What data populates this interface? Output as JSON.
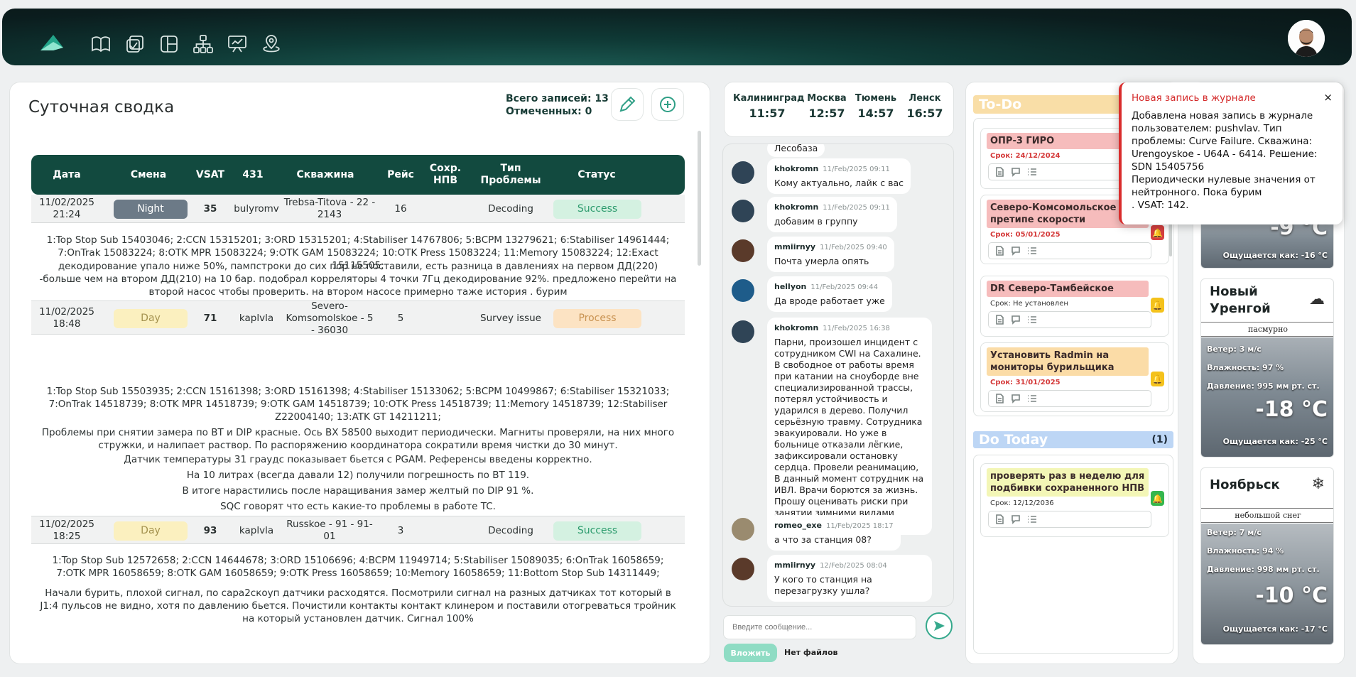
{
  "app": {
    "colors": {
      "primary": "#124a3f",
      "accent": "#35a98c",
      "alert": "#d92c2c"
    }
  },
  "nav": {
    "icons": [
      "book-icon",
      "checklist-icon",
      "layout-icon",
      "hierarchy-icon",
      "presentation-icon",
      "map-pin-icon"
    ]
  },
  "summary": {
    "title": "Суточная сводка",
    "total_label": "Всего записей: 13",
    "marked_label": "Отмеченных: 0",
    "columns": [
      "Дата",
      "Смена",
      "VSAT",
      "431",
      "Скважина",
      "Рейс",
      "Сохр. НПВ",
      "Тип Проблемы",
      "Статус"
    ],
    "rows": [
      {
        "date": "11/02/2025 21:24",
        "shift": "Night",
        "vsat": "35",
        "user": "bulyromv",
        "well": "Trebsa-Titova - 22 - 2143",
        "trip": "16",
        "npv": "",
        "problem": "Decoding",
        "status": "Success",
        "details": [
          "1:Top Stop Sub 15403046; 2:CCN 15315201; 3:ORD 15315201; 4:Stabiliser 14767806; 5:BCPM 13279621; 6:Stabiliser 14961444; 7:OnTrak 15083224; 8:OTK MPR 15083224; 9:OTK GAM 15083224; 10:OTK Press 15083224; 11:Memory 15083224; 12:Exact 15115505;",
          "декодирование упало ниже 50%, пампстроки до сих пор не поставили, есть разница в давлениях на первом ДД(220) -больше чем на втором ДД(210) на 10 бар. подобрал корреляторы 4 точки 7Гц декодирование 92%. предложено перейти на второй насос чтобы проверить. на втором насосе примерно таже история . бурим"
        ]
      },
      {
        "date": "11/02/2025 18:48",
        "shift": "Day",
        "vsat": "71",
        "user": "kaplvla",
        "well": "Severo-Komsomolskoe - 5 - 36030",
        "trip": "5",
        "npv": "",
        "problem": "Survey issue",
        "status": "Process",
        "details": [
          "1:Top Stop Sub 15503935; 2:CCN 15161398; 3:ORD 15161398; 4:Stabiliser 15133062; 5:BCPM 10499867; 6:Stabiliser 15321033; 7:OnTrak 14518739; 8:OTK MPR 14518739; 9:OTK GAM 14518739; 10:OTK Press 14518739; 11:Memory 14518739; 12:Stabiliser Z22004140; 13:ATK GT 14211211;",
          "Проблемы при снятии замера по BT и DIP красные. Ось BX 58500 выходит периодически. Магниты проверяли, на них много стружки, и налипает раствор. По распоряжению координатора сократили время чистки до 30 минут.",
          "Датчик температуры 31 граудс показывает бьется с PGAM. Референсы введены корректно.",
          "На 10 литрах (всегда давали 12) получили погрешность по BT 119.",
          "В итоге нарастились после наращивания замер желтый по DIP 91 %.",
          "SQC говорят что есть какие-то проблемы в работе TC."
        ]
      },
      {
        "date": "11/02/2025 18:25",
        "shift": "Day",
        "vsat": "93",
        "user": "kaplvla",
        "well": "Russkoe - 91 - 91-01",
        "trip": "3",
        "npv": "",
        "problem": "Decoding",
        "status": "Success",
        "details": [
          "1:Top Stop Sub 12572658; 2:CCN 14644678; 3:ORD 15106696; 4:BCPM 11949714; 5:Stabiliser 15089035; 6:OnTrak 16058659; 7:OTK MPR 16058659; 8:OTK GAM 16058659; 9:OTK Press 16058659; 10:Memory 16058659; 11:Bottom Stop Sub 14311449;",
          "Начали бурить, плохой сигнал, по сара2скоуп датчики расходятся. Посмотрили сигнал на разных датчиках тот который в J1:4 пульсов не видно, хотя по давлению бьется. Почистили контакты контакт клинером и поставили отогреваться тройник на который установлен датчик. Сигнал 100%"
        ]
      }
    ]
  },
  "clocks": [
    {
      "city": "Калининград",
      "time": "11:57"
    },
    {
      "city": "Москва",
      "time": "12:57"
    },
    {
      "city": "Тюмень",
      "time": "14:57"
    },
    {
      "city": "Ленск",
      "time": "16:57"
    }
  ],
  "chat": {
    "partial_top": "Лесобаза",
    "messages": [
      {
        "nick": "khokromn",
        "time": "11/Feb/2025 09:11",
        "text": "Кому актуально, лайк с вас"
      },
      {
        "nick": "khokromn",
        "time": "11/Feb/2025 09:11",
        "text": "добавим в группу"
      },
      {
        "nick": "mmiirnyy",
        "time": "11/Feb/2025 09:40",
        "text": "Почта умерла опять"
      },
      {
        "nick": "hellyon",
        "time": "11/Feb/2025 09:44",
        "text": "Да вроде работает уже"
      },
      {
        "nick": "khokromn",
        "time": "11/Feb/2025 16:38",
        "text": "Парни, произошел инцидент с сотрудником CWI на Сахалине. В свободное от работы время при катании на сноуборде вне специализированной трассы, потерял устойчивость и ударился в дерево. Получил серьёзную травму. Сотрудника эвакуировали. Но уже в больнице отказали лёгкие, зафиксировали остановку сердца. Провели реанимацию, В данный момент сотрудник на ИВЛ. Врачи борются за жизнь. Прошу оценивать риски при занятии зимними видами спорта. Берегите себя."
      },
      {
        "nick": "romeo_exe",
        "time": "11/Feb/2025 18:17",
        "text": "а что за станция 08?"
      },
      {
        "nick": "mmiirnyy",
        "time": "12/Feb/2025 08:04",
        "text": "У кого то станция на перезагрузку ушла?"
      }
    ],
    "input_placeholder": "Введите сообщение...",
    "attach_label": "Вложить",
    "no_files_label": "Нет файлов"
  },
  "board": {
    "todo_title": "To-Do",
    "todo_cards": [
      {
        "title": "ОПР-3 ГИРО",
        "due": "Срок: 24/12/2024",
        "color": "red",
        "bell": ""
      },
      {
        "title": "Северо-Комсомольское на претипе скорости",
        "due": "Срок: 05/01/2025",
        "color": "red",
        "bell": "red"
      },
      {
        "title": "DR Северо-Тамбейское",
        "due": "Срок: Не установлен",
        "color": "red",
        "bell": "yellow"
      },
      {
        "title": "Установить Radmin на мониторы бурильщика",
        "due": "Срок: 31/01/2025",
        "color": "yellow",
        "bell": "yellow"
      }
    ],
    "dotoday_title": "Do Today",
    "dotoday_count": "(1)",
    "dotoday_cards": [
      {
        "title": "проверять раз в неделю для подбивки сохраненного НПВ",
        "due": "Срок: 12/12/2036",
        "color": "lime",
        "bell": "green"
      }
    ]
  },
  "weather": [
    {
      "city": "",
      "cond": "",
      "wind": "",
      "humidity": "",
      "pressure": "",
      "temp": "-9 °C",
      "feels": "Ощущается как: -16 °C",
      "icon": ""
    },
    {
      "city": "Новый Уренгой",
      "cond": "пасмурно",
      "wind": "Ветер: 3 м/с",
      "humidity": "Влажность: 97 %",
      "pressure": "Давление: 995 мм рт. ст.",
      "temp": "-18 °C",
      "feels": "Ощущается как: -25 °C",
      "icon": "cloud-icon"
    },
    {
      "city": "Ноябрьск",
      "cond": "небольшой снег",
      "wind": "Ветер: 7 м/с",
      "humidity": "Влажность: 94 %",
      "pressure": "Давление: 998 мм рт. ст.",
      "temp": "-10 °C",
      "feels": "Ощущается как: -17 °C",
      "icon": "snowflake-icon"
    }
  ],
  "toast": {
    "title": "Новая запись в журнале",
    "close": "×",
    "body": "Добавлена новая запись в журнале пользователем: pushvlav. Тип проблемы: Curve Failure. Скважина: Urengoyskoe - U64A - 6414. Решение:\nSDN 15405756\nПериодически нулевые значения от нейтронного. Пока бурим\n. VSAT: 142."
  }
}
